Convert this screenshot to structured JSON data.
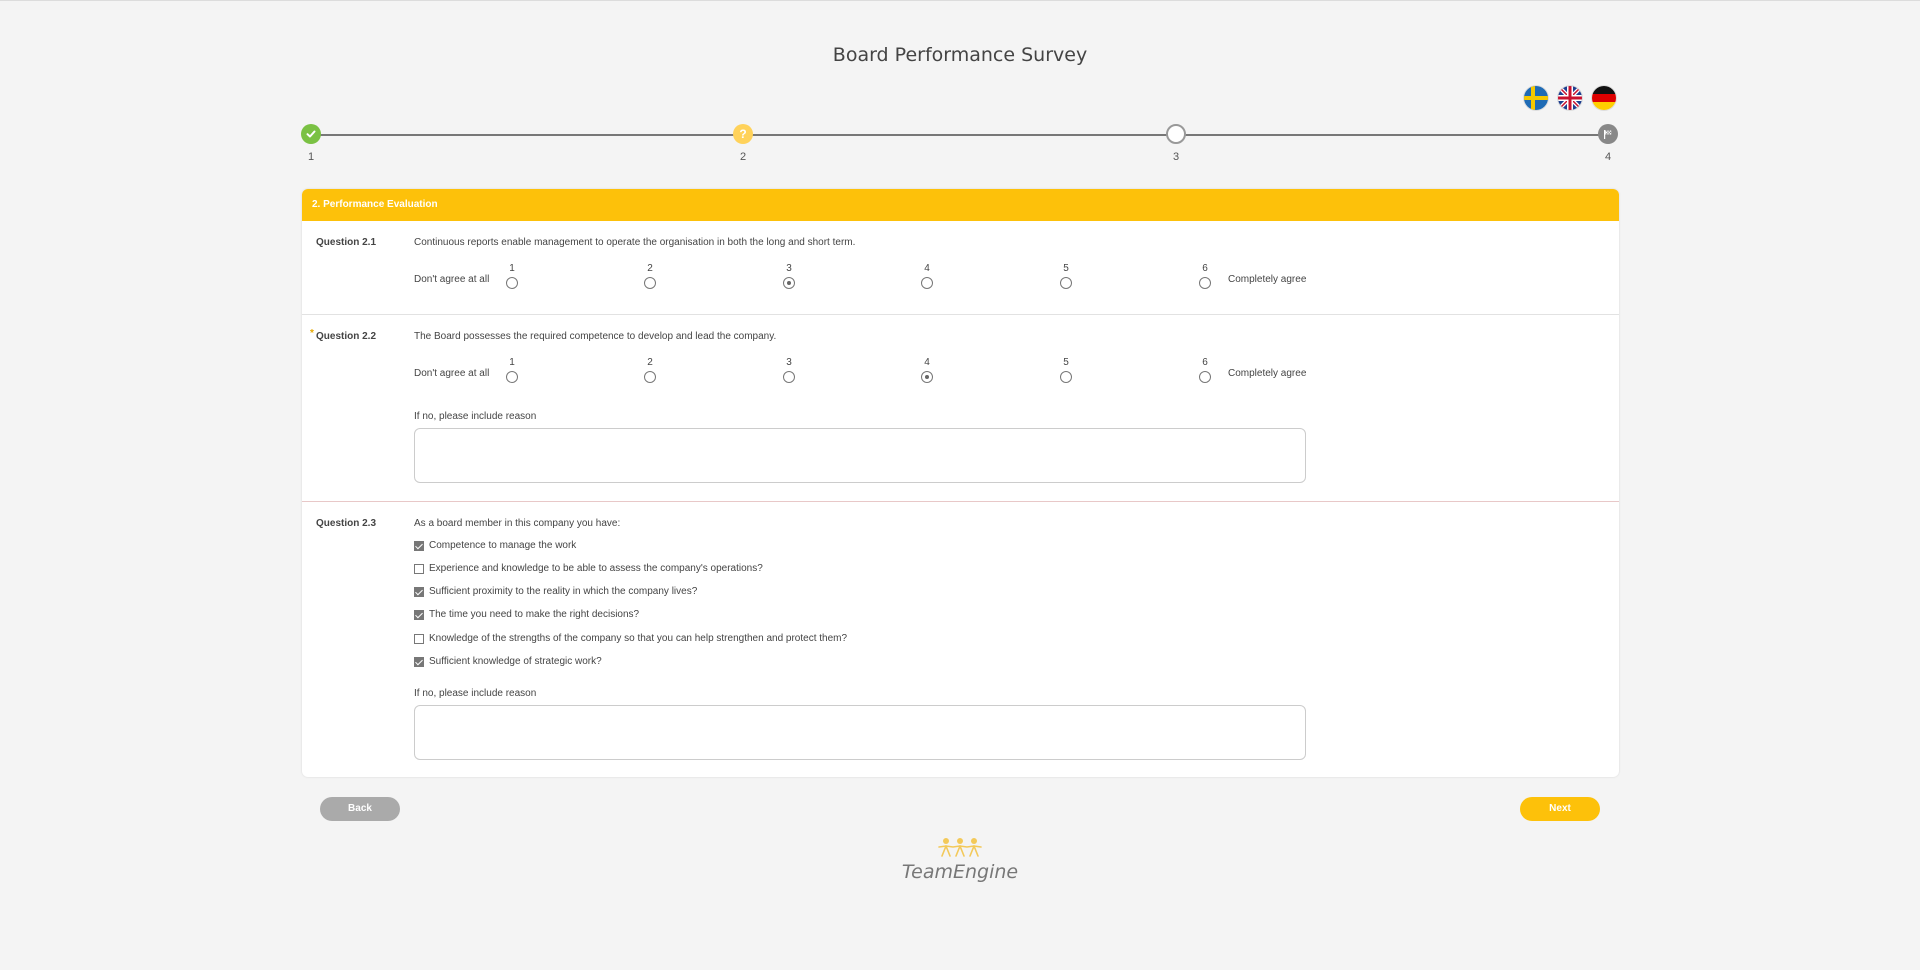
{
  "survey_title": "Board Performance Survey",
  "languages": [
    {
      "name": "swedish-flag-icon"
    },
    {
      "name": "uk-flag-icon"
    },
    {
      "name": "german-flag-icon"
    }
  ],
  "progress": {
    "steps": [
      {
        "label": "1",
        "state": "done"
      },
      {
        "label": "2",
        "state": "current",
        "glyph": "?"
      },
      {
        "label": "3",
        "state": "todo"
      },
      {
        "label": "4",
        "state": "final"
      }
    ]
  },
  "section": {
    "title": "2. Performance Evaluation",
    "accent": "#fdc10a"
  },
  "questions": {
    "q1": {
      "label": "Question 2.1",
      "text": "Continuous reports enable management to operate the organisation in both the long and short term.",
      "scale_left": "Don't agree at all",
      "scale_right": "Completely agree",
      "options": [
        "1",
        "2",
        "3",
        "4",
        "5",
        "6"
      ],
      "selected": "3"
    },
    "q2": {
      "label": "Question 2.2",
      "required_mark": "*",
      "text": "The Board possesses the required competence to develop and lead the company.",
      "scale_left": "Don't agree at all",
      "scale_right": "Completely agree",
      "options": [
        "1",
        "2",
        "3",
        "4",
        "5",
        "6"
      ],
      "selected": "4",
      "reason_label": "If no, please include reason",
      "reason_value": ""
    },
    "q3": {
      "label": "Question 2.3",
      "text": "As a board member in this company you have:",
      "items": [
        {
          "label": "Competence to manage the work",
          "checked": true
        },
        {
          "label": "Experience and knowledge to be able to assess the company's operations?",
          "checked": false
        },
        {
          "label": "Sufficient proximity to the reality in which the company lives?",
          "checked": true
        },
        {
          "label": "The time you need to make the right decisions?",
          "checked": true
        },
        {
          "label": "Knowledge of the strengths of the company so that you can help strengthen and protect them?",
          "checked": false
        },
        {
          "label": "Sufficient knowledge of strategic work?",
          "checked": true
        }
      ],
      "reason_label": "If no, please include reason",
      "reason_value": ""
    }
  },
  "nav": {
    "back_label": "Back",
    "next_label": "Next"
  },
  "footer": {
    "logo_text": "TeamEngine"
  },
  "colors": {
    "done": "#7ac143",
    "current": "#ffd25a",
    "back_button": "#aaaaaa",
    "next_button": "#fdc10a"
  }
}
